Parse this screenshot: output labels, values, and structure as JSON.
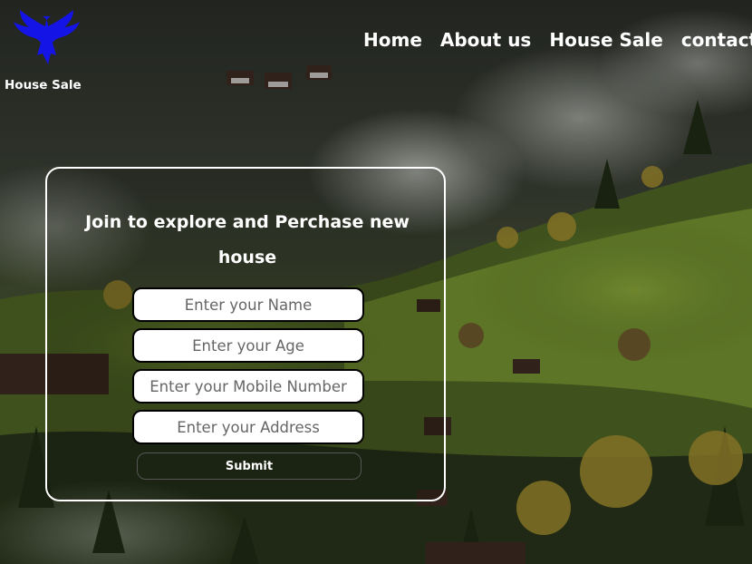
{
  "header": {
    "brand_name": "House Sale",
    "logo_icon": "eagle-icon",
    "nav": [
      {
        "label": "Home"
      },
      {
        "label": "About us"
      },
      {
        "label": "House Sale"
      },
      {
        "label": "contact"
      }
    ]
  },
  "form": {
    "title": "Join to explore and Perchase new house",
    "fields": [
      {
        "placeholder": "Enter your Name"
      },
      {
        "placeholder": "Enter your Age"
      },
      {
        "placeholder": "Enter your Mobile Number"
      },
      {
        "placeholder": "Enter your Address"
      }
    ],
    "submit_label": "Submit"
  },
  "colors": {
    "logo": "#1414e6",
    "text": "#ffffff",
    "card_border": "#ffffff",
    "input_border": "#000000"
  }
}
